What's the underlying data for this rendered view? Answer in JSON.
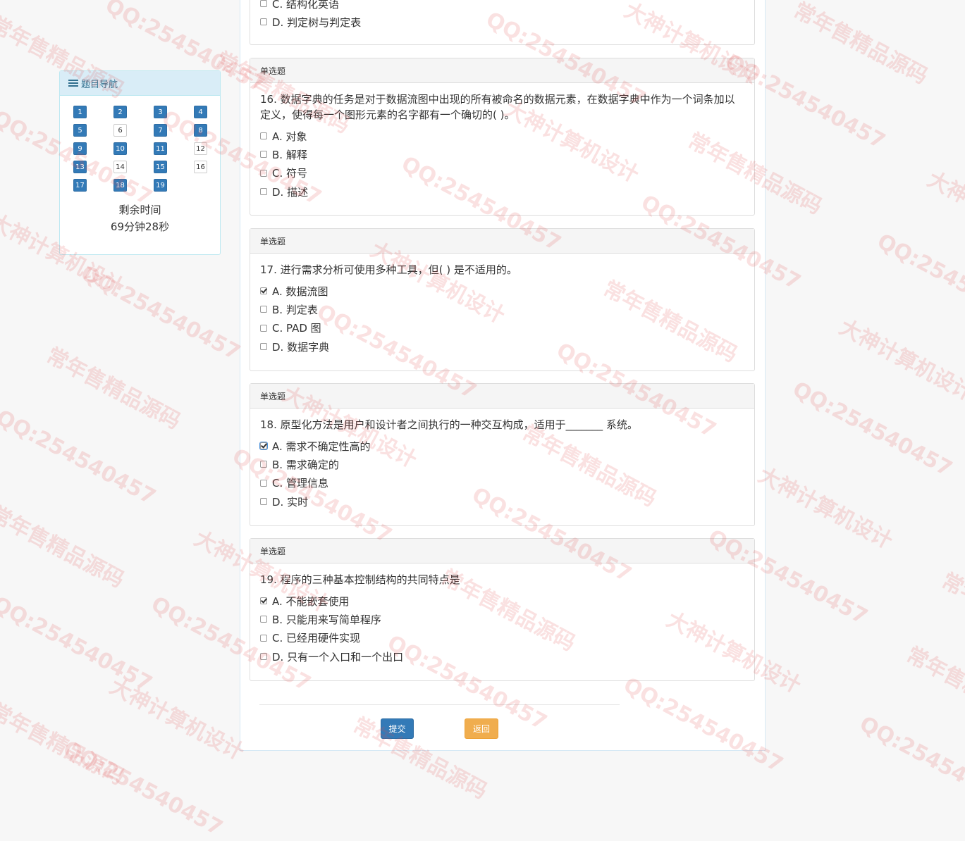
{
  "nav": {
    "title": "题目导航",
    "items": [
      {
        "num": "1",
        "state": "done"
      },
      {
        "num": "2",
        "state": "done"
      },
      {
        "num": "3",
        "state": "done"
      },
      {
        "num": "4",
        "state": "done"
      },
      {
        "num": "5",
        "state": "done"
      },
      {
        "num": "6",
        "state": "todo"
      },
      {
        "num": "7",
        "state": "done"
      },
      {
        "num": "8",
        "state": "done"
      },
      {
        "num": "9",
        "state": "done"
      },
      {
        "num": "10",
        "state": "done"
      },
      {
        "num": "11",
        "state": "done"
      },
      {
        "num": "12",
        "state": "todo"
      },
      {
        "num": "13",
        "state": "done"
      },
      {
        "num": "14",
        "state": "todo"
      },
      {
        "num": "15",
        "state": "done"
      },
      {
        "num": "16",
        "state": "todo"
      },
      {
        "num": "17",
        "state": "done"
      },
      {
        "num": "18",
        "state": "done"
      },
      {
        "num": "19",
        "state": "done"
      }
    ],
    "time_label": "剩余时间",
    "time_value": "69分钟28秒"
  },
  "partial_question": {
    "options": [
      {
        "text": "C. 结构化英语",
        "checked": false
      },
      {
        "text": "D. 判定树与判定表",
        "checked": false
      }
    ]
  },
  "questions": [
    {
      "type": "单选题",
      "text": "16. 数据字典的任务是对于数据流图中出现的所有被命名的数据元素，在数据字典中作为一个词条加以定义，使得每一个图形元素的名字都有一个确切的( )。",
      "options": [
        {
          "text": "A. 对象",
          "checked": false
        },
        {
          "text": "B. 解释",
          "checked": false
        },
        {
          "text": "C. 符号",
          "checked": false
        },
        {
          "text": "D. 描述",
          "checked": false
        }
      ]
    },
    {
      "type": "单选题",
      "text": "17. 进行需求分析可使用多种工具，但( ) 是不适用的。",
      "options": [
        {
          "text": "A. 数据流图",
          "checked": true
        },
        {
          "text": "B. 判定表",
          "checked": false
        },
        {
          "text": "C. PAD 图",
          "checked": false
        },
        {
          "text": "D. 数据字典",
          "checked": false
        }
      ]
    },
    {
      "type": "单选题",
      "text": "18. 原型化方法是用户和设计者之间执行的一种交互构成，适用于_______ 系统。",
      "options": [
        {
          "text": "A. 需求不确定性高的",
          "checked": true
        },
        {
          "text": "B. 需求确定的",
          "checked": false
        },
        {
          "text": "C. 管理信息",
          "checked": false
        },
        {
          "text": "D. 实时",
          "checked": false
        }
      ]
    },
    {
      "type": "单选题",
      "text": "19. 程序的三种基本控制结构的共同特点是",
      "options": [
        {
          "text": "A. 不能嵌套使用",
          "checked": true
        },
        {
          "text": "B. 只能用来写简单程序",
          "checked": false
        },
        {
          "text": "C. 已经用硬件实现",
          "checked": false
        },
        {
          "text": "D. 只有一个入口和一个出口",
          "checked": false
        }
      ]
    }
  ],
  "buttons": {
    "submit": "提交",
    "back": "返回"
  },
  "watermarks": [
    "QQ:254540457",
    "常年售精品源码",
    "大神计算机设计"
  ],
  "colors": {
    "primary": "#337ab7",
    "warning": "#f0ad4e",
    "nav_header": "#d9edf7"
  }
}
